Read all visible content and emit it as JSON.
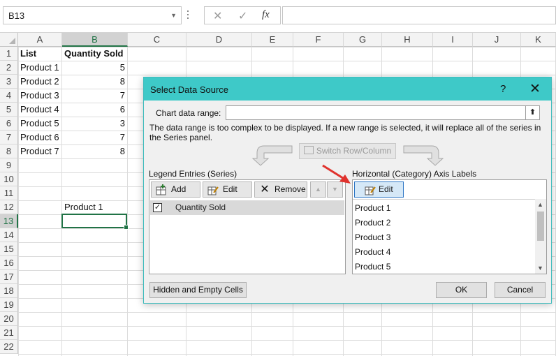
{
  "formula_bar": {
    "name_box": "B13",
    "cancel_icon": "✕",
    "enter_icon": "✓",
    "function_icon": "fx"
  },
  "columns": [
    "A",
    "B",
    "C",
    "D",
    "E",
    "F",
    "G",
    "H",
    "I",
    "J",
    "K"
  ],
  "selected_column": "B",
  "rows": [
    "1",
    "2",
    "3",
    "4",
    "5",
    "6",
    "7",
    "8",
    "9",
    "10",
    "11",
    "12",
    "13",
    "14",
    "15",
    "16",
    "17",
    "18",
    "19",
    "20",
    "21",
    "22"
  ],
  "selected_row": "13",
  "sheet": {
    "header_a": "List",
    "header_b": "Quantity Sold",
    "data": [
      {
        "name": "Product 1",
        "qty": "5"
      },
      {
        "name": "Product 2",
        "qty": "8"
      },
      {
        "name": "Product 3",
        "qty": "7"
      },
      {
        "name": "Product 4",
        "qty": "6"
      },
      {
        "name": "Product 5",
        "qty": "3"
      },
      {
        "name": "Product 6",
        "qty": "7"
      },
      {
        "name": "Product 7",
        "qty": "8"
      }
    ],
    "b12": "Product 1"
  },
  "dialog": {
    "title": "Select Data Source",
    "help": "?",
    "close": "✕",
    "chart_range_label": "Chart data range:",
    "chart_range_value": "",
    "message": "The data range is too complex to be displayed. If a new range is selected, it will replace all of the series in the Series panel.",
    "switch_label": "Switch Row/Column",
    "legend_label": "Legend Entries (Series)",
    "add_label": "Add",
    "edit_label": "Edit",
    "remove_label": "Remove",
    "series": [
      {
        "name": "Quantity Sold",
        "checked": true
      }
    ],
    "axis_label": "Horizontal (Category) Axis Labels",
    "axis_edit_label": "Edit",
    "axis_labels": [
      "Product 1",
      "Product 2",
      "Product 3",
      "Product 4",
      "Product 5"
    ],
    "hidden_cells_label": "Hidden and Empty Cells",
    "ok_label": "OK",
    "cancel_label": "Cancel"
  }
}
